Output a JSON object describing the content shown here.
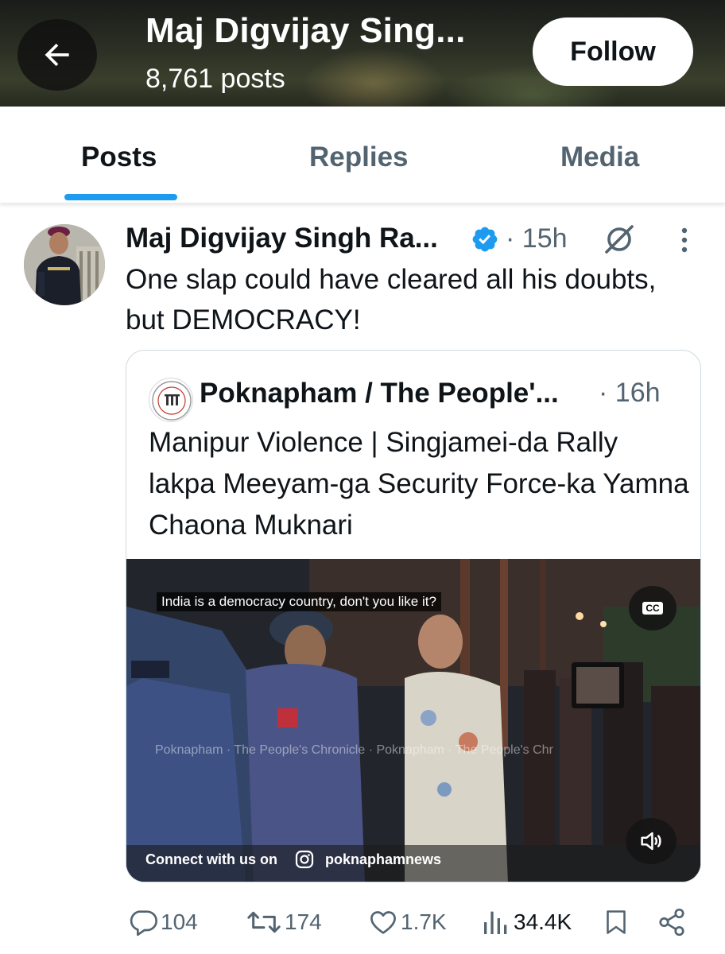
{
  "header": {
    "title": "Maj Digvijay Sing...",
    "post_count": "8,761 posts",
    "follow_label": "Follow"
  },
  "tabs": [
    {
      "label": "Posts",
      "active": true
    },
    {
      "label": "Replies",
      "active": false
    },
    {
      "label": "Media",
      "active": false
    }
  ],
  "tweet": {
    "author": "Maj Digvijay Singh Ra...",
    "separator": "·",
    "time": "15h",
    "text": "One slap could have cleared all his doubts, but DEMOCRACY!",
    "quote": {
      "author": "Poknapham / The People'...",
      "time": "16h",
      "text": "Manipur Violence | Singjamei-da Rally lakpa Meeyam-ga Security Force-ka Yamna Chaona Muknari",
      "video": {
        "subtitle": "India is a democracy country, don't you like it?",
        "cc_label": "CC",
        "connect_label": "Connect with us on",
        "handle": "poknaphamnews",
        "watermark": "Poknapham · The People's Chronicle · Poknapham · The People's Chr"
      }
    },
    "actions": {
      "replies": "104",
      "reposts": "174",
      "likes": "1.7K",
      "views": "34.4K"
    }
  },
  "colors": {
    "accent": "#1d9bf0",
    "text_primary": "#0f1419",
    "text_secondary": "#536471",
    "border": "#cfd9de"
  },
  "icons": [
    "back-arrow-icon",
    "verified-badge-icon",
    "grok-icon",
    "more-vertical-icon",
    "cc-icon",
    "volume-icon",
    "instagram-icon",
    "reply-icon",
    "repost-icon",
    "like-icon",
    "views-icon",
    "bookmark-icon",
    "share-icon"
  ]
}
